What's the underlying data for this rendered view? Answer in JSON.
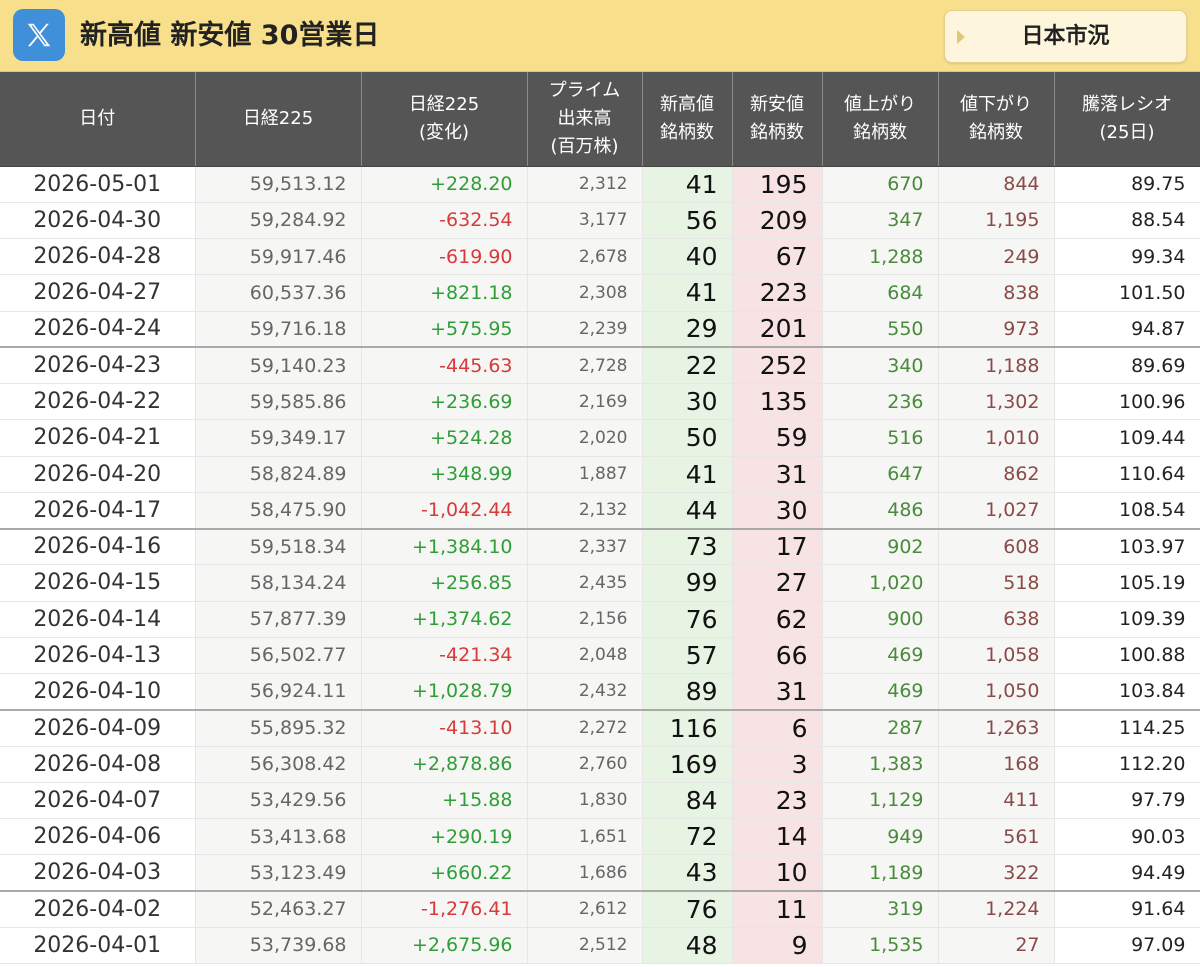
{
  "header": {
    "title": "新高値 新安値 30営業日",
    "market_button": "日本市況",
    "logo_icon": "x-logo-icon"
  },
  "colors": {
    "titlebar": "#f7df8c",
    "header_bg": "#555555",
    "positive": "#2f9e39",
    "negative": "#d63a3a",
    "new_high_bg": "#e7f4e4",
    "new_low_bg": "#f7e3e3"
  },
  "columns": [
    [
      "日付"
    ],
    [
      "日経225"
    ],
    [
      "日経225",
      "(変化)"
    ],
    [
      "プライム",
      "出来高",
      "(百万株)"
    ],
    [
      "新高値",
      "銘柄数"
    ],
    [
      "新安値",
      "銘柄数"
    ],
    [
      "値上がり",
      "銘柄数"
    ],
    [
      "値下がり",
      "銘柄数"
    ],
    [
      "騰落レシオ",
      "(25日)"
    ]
  ],
  "rows": [
    {
      "date": "2026-05-01",
      "nikkei": "59,513.12",
      "change": "+228.20",
      "volume": "2,312",
      "new_high": "41",
      "new_low": "195",
      "advancers": "670",
      "decliners": "844",
      "ratio": "89.75"
    },
    {
      "date": "2026-04-30",
      "nikkei": "59,284.92",
      "change": "-632.54",
      "volume": "3,177",
      "new_high": "56",
      "new_low": "209",
      "advancers": "347",
      "decliners": "1,195",
      "ratio": "88.54"
    },
    {
      "date": "2026-04-28",
      "nikkei": "59,917.46",
      "change": "-619.90",
      "volume": "2,678",
      "new_high": "40",
      "new_low": "67",
      "advancers": "1,288",
      "decliners": "249",
      "ratio": "99.34"
    },
    {
      "date": "2026-04-27",
      "nikkei": "60,537.36",
      "change": "+821.18",
      "volume": "2,308",
      "new_high": "41",
      "new_low": "223",
      "advancers": "684",
      "decliners": "838",
      "ratio": "101.50"
    },
    {
      "date": "2026-04-24",
      "nikkei": "59,716.18",
      "change": "+575.95",
      "volume": "2,239",
      "new_high": "29",
      "new_low": "201",
      "advancers": "550",
      "decliners": "973",
      "ratio": "94.87"
    },
    {
      "date": "2026-04-23",
      "nikkei": "59,140.23",
      "change": "-445.63",
      "volume": "2,728",
      "new_high": "22",
      "new_low": "252",
      "advancers": "340",
      "decliners": "1,188",
      "ratio": "89.69"
    },
    {
      "date": "2026-04-22",
      "nikkei": "59,585.86",
      "change": "+236.69",
      "volume": "2,169",
      "new_high": "30",
      "new_low": "135",
      "advancers": "236",
      "decliners": "1,302",
      "ratio": "100.96"
    },
    {
      "date": "2026-04-21",
      "nikkei": "59,349.17",
      "change": "+524.28",
      "volume": "2,020",
      "new_high": "50",
      "new_low": "59",
      "advancers": "516",
      "decliners": "1,010",
      "ratio": "109.44"
    },
    {
      "date": "2026-04-20",
      "nikkei": "58,824.89",
      "change": "+348.99",
      "volume": "1,887",
      "new_high": "41",
      "new_low": "31",
      "advancers": "647",
      "decliners": "862",
      "ratio": "110.64"
    },
    {
      "date": "2026-04-17",
      "nikkei": "58,475.90",
      "change": "-1,042.44",
      "volume": "2,132",
      "new_high": "44",
      "new_low": "30",
      "advancers": "486",
      "decliners": "1,027",
      "ratio": "108.54"
    },
    {
      "date": "2026-04-16",
      "nikkei": "59,518.34",
      "change": "+1,384.10",
      "volume": "2,337",
      "new_high": "73",
      "new_low": "17",
      "advancers": "902",
      "decliners": "608",
      "ratio": "103.97"
    },
    {
      "date": "2026-04-15",
      "nikkei": "58,134.24",
      "change": "+256.85",
      "volume": "2,435",
      "new_high": "99",
      "new_low": "27",
      "advancers": "1,020",
      "decliners": "518",
      "ratio": "105.19"
    },
    {
      "date": "2026-04-14",
      "nikkei": "57,877.39",
      "change": "+1,374.62",
      "volume": "2,156",
      "new_high": "76",
      "new_low": "62",
      "advancers": "900",
      "decliners": "638",
      "ratio": "109.39"
    },
    {
      "date": "2026-04-13",
      "nikkei": "56,502.77",
      "change": "-421.34",
      "volume": "2,048",
      "new_high": "57",
      "new_low": "66",
      "advancers": "469",
      "decliners": "1,058",
      "ratio": "100.88"
    },
    {
      "date": "2026-04-10",
      "nikkei": "56,924.11",
      "change": "+1,028.79",
      "volume": "2,432",
      "new_high": "89",
      "new_low": "31",
      "advancers": "469",
      "decliners": "1,050",
      "ratio": "103.84"
    },
    {
      "date": "2026-04-09",
      "nikkei": "55,895.32",
      "change": "-413.10",
      "volume": "2,272",
      "new_high": "116",
      "new_low": "6",
      "advancers": "287",
      "decliners": "1,263",
      "ratio": "114.25"
    },
    {
      "date": "2026-04-08",
      "nikkei": "56,308.42",
      "change": "+2,878.86",
      "volume": "2,760",
      "new_high": "169",
      "new_low": "3",
      "advancers": "1,383",
      "decliners": "168",
      "ratio": "112.20"
    },
    {
      "date": "2026-04-07",
      "nikkei": "53,429.56",
      "change": "+15.88",
      "volume": "1,830",
      "new_high": "84",
      "new_low": "23",
      "advancers": "1,129",
      "decliners": "411",
      "ratio": "97.79"
    },
    {
      "date": "2026-04-06",
      "nikkei": "53,413.68",
      "change": "+290.19",
      "volume": "1,651",
      "new_high": "72",
      "new_low": "14",
      "advancers": "949",
      "decliners": "561",
      "ratio": "90.03"
    },
    {
      "date": "2026-04-03",
      "nikkei": "53,123.49",
      "change": "+660.22",
      "volume": "1,686",
      "new_high": "43",
      "new_low": "10",
      "advancers": "1,189",
      "decliners": "322",
      "ratio": "94.49"
    },
    {
      "date": "2026-04-02",
      "nikkei": "52,463.27",
      "change": "-1,276.41",
      "volume": "2,612",
      "new_high": "76",
      "new_low": "11",
      "advancers": "319",
      "decliners": "1,224",
      "ratio": "91.64"
    },
    {
      "date": "2026-04-01",
      "nikkei": "53,739.68",
      "change": "+2,675.96",
      "volume": "2,512",
      "new_high": "48",
      "new_low": "9",
      "advancers": "1,535",
      "decliners": "27",
      "ratio": "97.09"
    }
  ]
}
